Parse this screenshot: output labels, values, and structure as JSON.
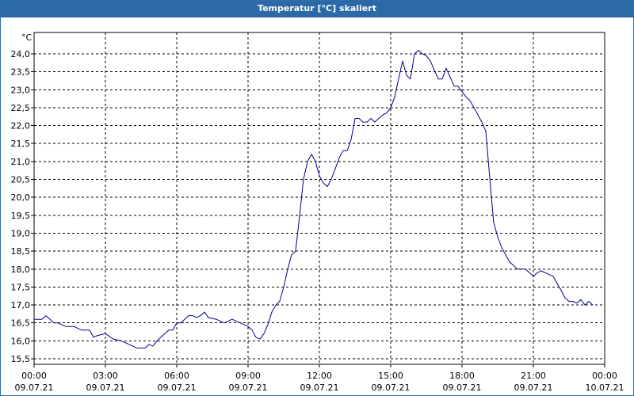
{
  "window": {
    "title": "Temperatur [°C] skaliert"
  },
  "colors": {
    "titlebar": "#2b6aa6",
    "series": "#00008b",
    "grid": "#000000"
  },
  "chart_data": {
    "type": "line",
    "title": "Temperatur [°C] skaliert",
    "unit_label": "°C",
    "grid": true,
    "grid_style": "dashed",
    "legend": "none",
    "x_range_hours": [
      0,
      24
    ],
    "y_range": [
      15.5,
      24.0
    ],
    "y_ticks": [
      "15,5",
      "16,0",
      "16,5",
      "17,0",
      "17,5",
      "18,0",
      "18,5",
      "19,0",
      "19,5",
      "20,0",
      "20,5",
      "21,0",
      "21,5",
      "22,0",
      "22,5",
      "23,0",
      "23,5",
      "24,0"
    ],
    "x_ticks": [
      {
        "time": "00:00",
        "date": "09.07.21"
      },
      {
        "time": "03:00",
        "date": "09.07.21"
      },
      {
        "time": "06:00",
        "date": "09.07.21"
      },
      {
        "time": "09:00",
        "date": "09.07.21"
      },
      {
        "time": "12:00",
        "date": "09.07.21"
      },
      {
        "time": "15:00",
        "date": "09.07.21"
      },
      {
        "time": "18:00",
        "date": "09.07.21"
      },
      {
        "time": "21:00",
        "date": "09.07.21"
      },
      {
        "time": "00:00",
        "date": "10.07.21"
      }
    ],
    "series": [
      {
        "x_hours": [
          0.0,
          0.33,
          0.5,
          0.67,
          0.83,
          1.0,
          1.33,
          1.67,
          2.0,
          2.33,
          2.5,
          2.67,
          3.0,
          3.33,
          3.67,
          4.0,
          4.33,
          4.67,
          4.83,
          5.0,
          5.17,
          5.33,
          5.67,
          5.83,
          6.0,
          6.17,
          6.33,
          6.5,
          6.67,
          6.83,
          7.0,
          7.17,
          7.33,
          7.67,
          8.0,
          8.33,
          8.67,
          9.0,
          9.17,
          9.33,
          9.5,
          9.67,
          9.83,
          10.0,
          10.17,
          10.33,
          10.5,
          10.67,
          10.83,
          11.0,
          11.17,
          11.33,
          11.5,
          11.67,
          11.83,
          12.0,
          12.17,
          12.33,
          12.5,
          12.67,
          12.83,
          13.0,
          13.17,
          13.33,
          13.5,
          13.67,
          13.83,
          14.0,
          14.17,
          14.33,
          14.5,
          14.67,
          14.83,
          15.0,
          15.17,
          15.33,
          15.5,
          15.67,
          15.83,
          16.0,
          16.17,
          16.33,
          16.5,
          16.67,
          16.83,
          17.0,
          17.17,
          17.33,
          17.5,
          17.67,
          17.83,
          18.0,
          18.17,
          18.33,
          18.5,
          18.67,
          18.83,
          19.0,
          19.17,
          19.33,
          19.5,
          19.67,
          19.83,
          20.0,
          20.17,
          20.33,
          20.5,
          20.67,
          20.83,
          21.0,
          21.17,
          21.33,
          21.5,
          21.67,
          21.83,
          22.0,
          22.17,
          22.33,
          22.5,
          22.67,
          22.83,
          23.0,
          23.17,
          23.33,
          23.5,
          23.67,
          23.83,
          24.0
        ],
        "y": [
          16.6,
          16.6,
          16.7,
          16.6,
          16.5,
          16.5,
          16.4,
          16.4,
          16.3,
          16.3,
          16.1,
          16.15,
          16.2,
          16.05,
          16.0,
          15.9,
          15.8,
          15.8,
          15.9,
          15.85,
          16.0,
          16.1,
          16.3,
          16.3,
          16.5,
          16.5,
          16.6,
          16.7,
          16.7,
          16.65,
          16.7,
          16.8,
          16.65,
          16.6,
          16.5,
          16.6,
          16.5,
          16.4,
          16.3,
          16.1,
          16.05,
          16.2,
          16.45,
          16.8,
          17.0,
          17.1,
          17.5,
          18.0,
          18.4,
          18.5,
          19.5,
          20.5,
          21.0,
          21.2,
          21.0,
          20.6,
          20.4,
          20.3,
          20.5,
          20.8,
          21.1,
          21.3,
          21.3,
          21.6,
          22.2,
          22.2,
          22.1,
          22.1,
          22.2,
          22.1,
          22.2,
          22.3,
          22.35,
          22.5,
          22.8,
          23.3,
          23.8,
          23.4,
          23.3,
          24.0,
          24.1,
          24.0,
          23.95,
          23.8,
          23.55,
          23.3,
          23.3,
          23.6,
          23.35,
          23.1,
          23.1,
          22.95,
          22.8,
          22.7,
          22.5,
          22.3,
          22.1,
          21.85,
          20.5,
          19.3,
          18.9,
          18.6,
          18.4,
          18.2,
          18.1,
          18.0,
          18.0,
          18.0,
          17.9,
          17.8,
          17.9,
          17.95,
          17.9,
          17.85,
          17.8,
          17.6,
          17.4,
          17.2,
          17.1,
          17.1,
          17.05,
          17.15,
          17.0,
          17.1,
          17.0
        ]
      }
    ]
  }
}
